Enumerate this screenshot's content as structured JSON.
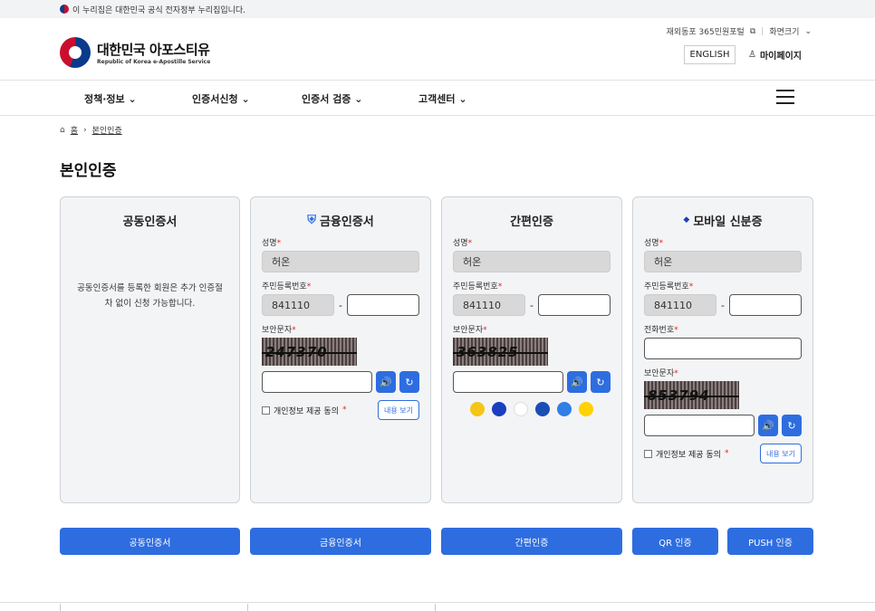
{
  "gov_banner": {
    "text": "이 누리집은 대한민국 공식 전자정부 누리집입니다."
  },
  "util": {
    "petition": "재외동포 365민원포털",
    "font_size": "화면크기"
  },
  "logo": {
    "title": "대한민국 아포스티유",
    "subtitle": "Republic of Korea e-Apostille Service"
  },
  "header": {
    "english": "ENGLISH",
    "mypage": "마이페이지"
  },
  "gnb": [
    "정책·정보",
    "인증서신청",
    "인증서 검증",
    "고객센터"
  ],
  "breadcrumb": {
    "home": "홈",
    "current": "본인인증"
  },
  "page_title": "본인인증",
  "cards": {
    "joint": {
      "title": "공동인증서",
      "desc1": "공동인증서를 등록한 회원은 추가 인증절",
      "desc2": "차 없이 신청 가능합니다."
    },
    "finance": {
      "title": "금융인증서",
      "name_label": "성명",
      "name_value": "허온",
      "rrn_label": "주민등록번호",
      "rrn_front": "841110",
      "captcha_label": "보안문자",
      "captcha": "247370",
      "agree": "개인정보 제공 동의",
      "view": "내용 보기"
    },
    "simple": {
      "title": "간편인증",
      "name_label": "성명",
      "name_value": "허온",
      "rrn_label": "주민등록번호",
      "rrn_front": "841110",
      "captcha_label": "보안문자",
      "captcha": "363825"
    },
    "mobile": {
      "title": "모바일 신분증",
      "name_label": "성명",
      "name_value": "허온",
      "rrn_label": "주민등록번호",
      "rrn_front": "841110",
      "phone_label": "전화번호",
      "captcha_label": "보안문자",
      "captcha": "853794",
      "agree": "개인정보 제공 동의",
      "view": "내용 보기"
    }
  },
  "buttons": [
    "공동인증서",
    "금융인증서",
    "간편인증",
    "QR 인증",
    "PUSH 인증"
  ],
  "colors": {
    "primary": "#2e6de0",
    "required": "#e02424"
  }
}
